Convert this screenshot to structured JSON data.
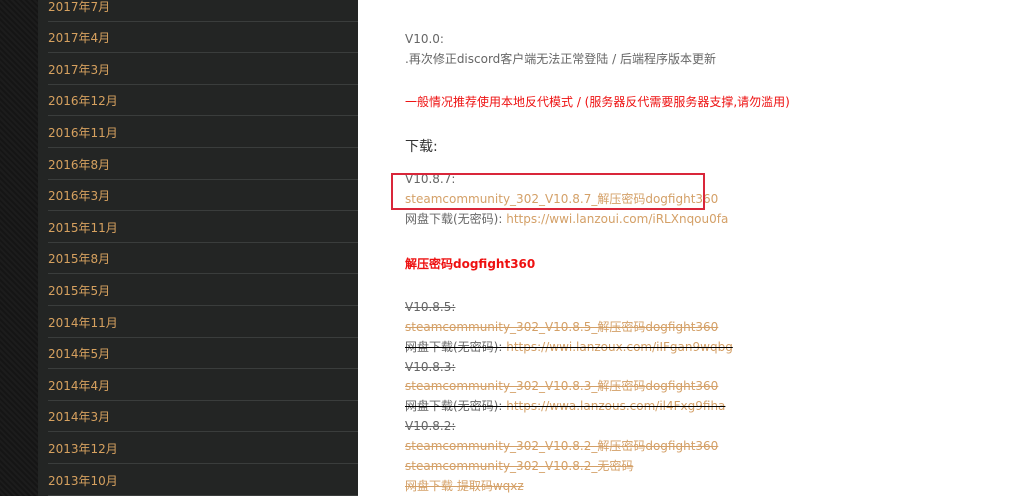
{
  "sidebar": {
    "archives": [
      "2017年7月",
      "2017年4月",
      "2017年3月",
      "2016年12月",
      "2016年11月",
      "2016年8月",
      "2016年3月",
      "2015年11月",
      "2015年8月",
      "2015年5月",
      "2014年11月",
      "2014年5月",
      "2014年4月",
      "2014年3月",
      "2013年12月",
      "2013年10月"
    ]
  },
  "content": {
    "v100_title": "V10.0:",
    "v100_note": ".再次修正discord客户端无法正常登陆 / 后端程序版本更新",
    "recommend": "一般情况推荐使用本地反代模式 / (服务器反代需要服务器支撑,请勿滥用)",
    "download_heading": "下载:",
    "v1087_title": "V10.8.7:",
    "v1087_file": "steamcommunity_302_V10.8.7_解压密码dogfight360",
    "v1087_pan_label": "网盘下载(无密码): ",
    "v1087_pan_link": "https://wwi.lanzoui.com/iRLXnqou0fa",
    "password_note": "解压密码dogfight360",
    "v1085_title": "V10.8.5:",
    "v1085_file": "steamcommunity_302_V10.8.5_解压密码dogfight360",
    "v1085_pan_label": "网盘下载(无密码): ",
    "v1085_pan_link": "https://wwi.lanzoux.com/iIFgan9wqbg",
    "v1083_title": "V10.8.3:",
    "v1083_file": "steamcommunity_302_V10.8.3_解压密码dogfight360",
    "v1083_pan_label": "网盘下载(无密码): ",
    "v1083_pan_link": "https://wwa.lanzous.com/il4Fxg9fiha",
    "v1082_title": "V10.8.2:",
    "v1082_file": "steamcommunity_302_V10.8.2_解压密码dogfight360",
    "v1082_file_nopw": "steamcommunity_302_V10.8.2_无密码",
    "v1082_pan": "网盘下载 提取码wqxz"
  }
}
